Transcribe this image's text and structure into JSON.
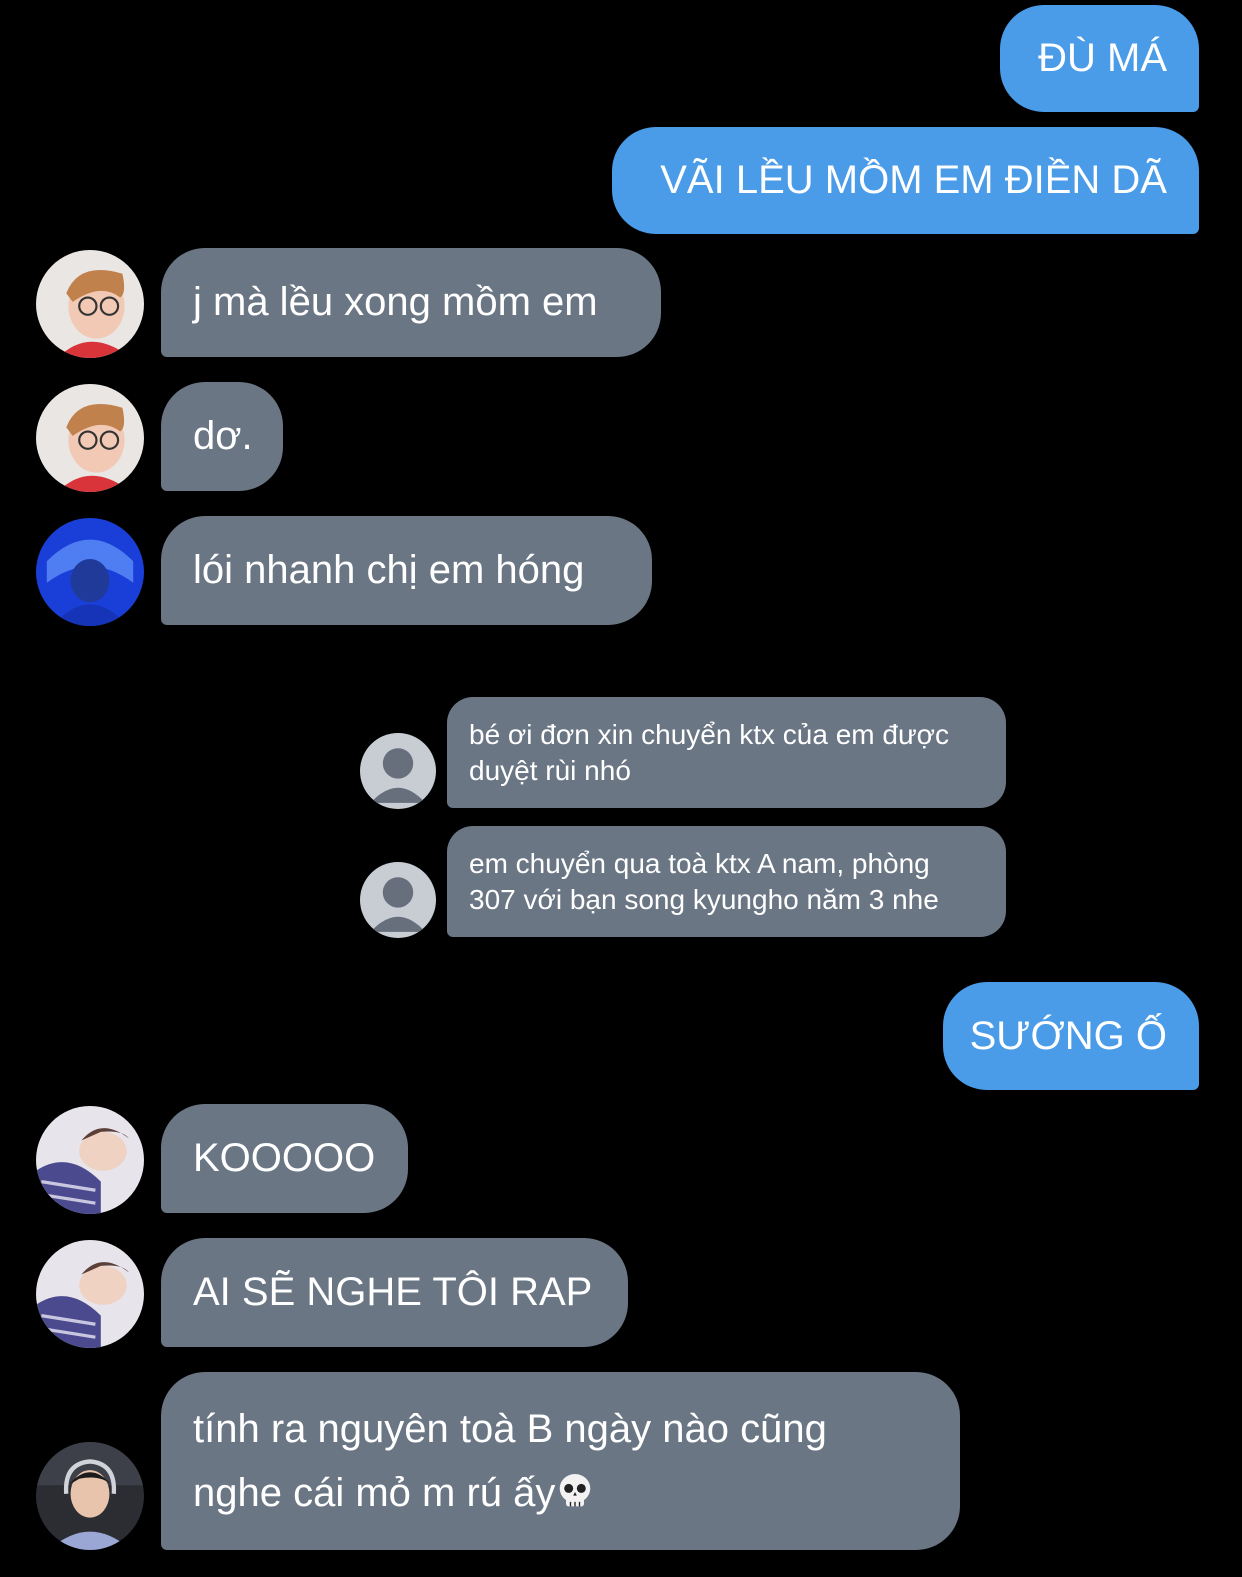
{
  "messages": [
    {
      "id": "m1",
      "direction": "outgoing",
      "text": "ĐÙ MÁ"
    },
    {
      "id": "m2",
      "direction": "outgoing",
      "text": "VÃI LỀU MỒM EM ĐIỀN DÃ"
    },
    {
      "id": "m3",
      "direction": "incoming",
      "avatar": "glasses-boy-avatar",
      "text": "j mà lều xong mồm em"
    },
    {
      "id": "m4",
      "direction": "incoming",
      "avatar": "glasses-boy-avatar",
      "text": "dơ."
    },
    {
      "id": "m5",
      "direction": "incoming",
      "avatar": "blue-hood-avatar",
      "text": "lói nhanh chị em hóng"
    },
    {
      "id": "m6",
      "direction": "incoming",
      "avatar": "default-user-avatar",
      "text": "bé ơi đơn xin chuyển ktx của em được duyệt rùi nhó"
    },
    {
      "id": "m7",
      "direction": "incoming",
      "avatar": "default-user-avatar",
      "text": "em chuyển qua toà ktx A nam, phòng 307 với bạn song kyungho năm 3 nhe"
    },
    {
      "id": "m8",
      "direction": "outgoing",
      "text": "SƯỚNG Ố"
    },
    {
      "id": "m9",
      "direction": "incoming",
      "avatar": "sleeping-boy-avatar",
      "text": "KOOOOO"
    },
    {
      "id": "m10",
      "direction": "incoming",
      "avatar": "sleeping-boy-avatar",
      "text": "AI SẼ NGHE TÔI RAP"
    },
    {
      "id": "m11",
      "direction": "incoming",
      "avatar": "headset-boy-avatar",
      "text": "tính ra nguyên toà B ngày nào cũng nghe cái mỏ m rú ấy",
      "emoji": "skull-icon"
    }
  ],
  "colors": {
    "background": "#000000",
    "outgoing_bubble": "#4a9be8",
    "incoming_bubble": "#6a7684",
    "text": "#ffffff"
  }
}
